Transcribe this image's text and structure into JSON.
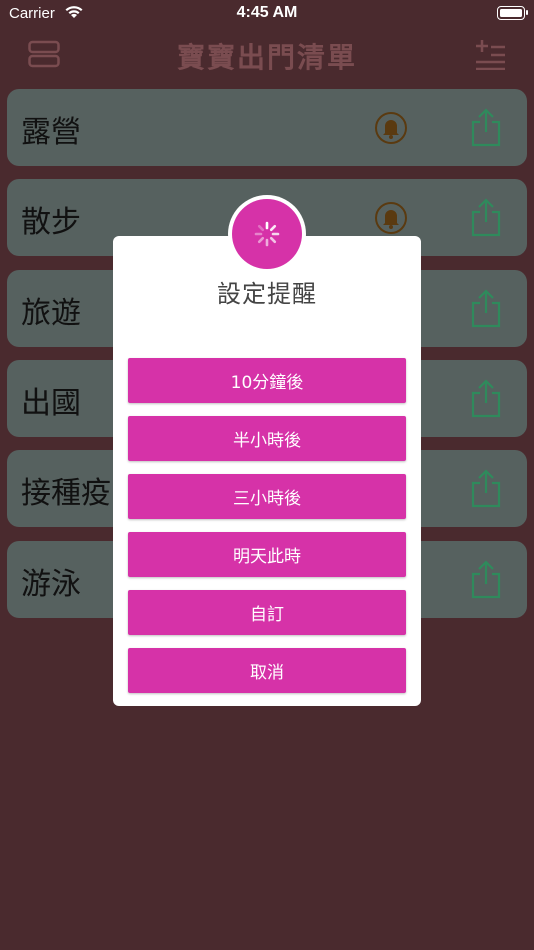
{
  "status_bar": {
    "carrier": "Carrier",
    "time": "4:45 AM"
  },
  "nav": {
    "title": "寶寶出門清單",
    "left_icon": "list-view-icon",
    "right_icon": "add-list-icon"
  },
  "list": [
    {
      "title": "露營",
      "has_bell": true
    },
    {
      "title": "散步",
      "has_bell": true
    },
    {
      "title": "旅遊",
      "has_bell": false
    },
    {
      "title": "出國",
      "has_bell": false
    },
    {
      "title": "接種疫",
      "has_bell": false
    },
    {
      "title": "游泳",
      "has_bell": false
    }
  ],
  "modal": {
    "title": "設定提醒",
    "badge_icon": "spinner-icon",
    "options": [
      "10分鐘後",
      "半小時後",
      "三小時後",
      "明天此時",
      "自訂",
      "取消"
    ]
  },
  "colors": {
    "background": "#4a2a2e",
    "row": "#56615f",
    "accent": "#d632a8",
    "share_icon": "#2f8a5c",
    "bell_icon": "#5a3a10"
  }
}
